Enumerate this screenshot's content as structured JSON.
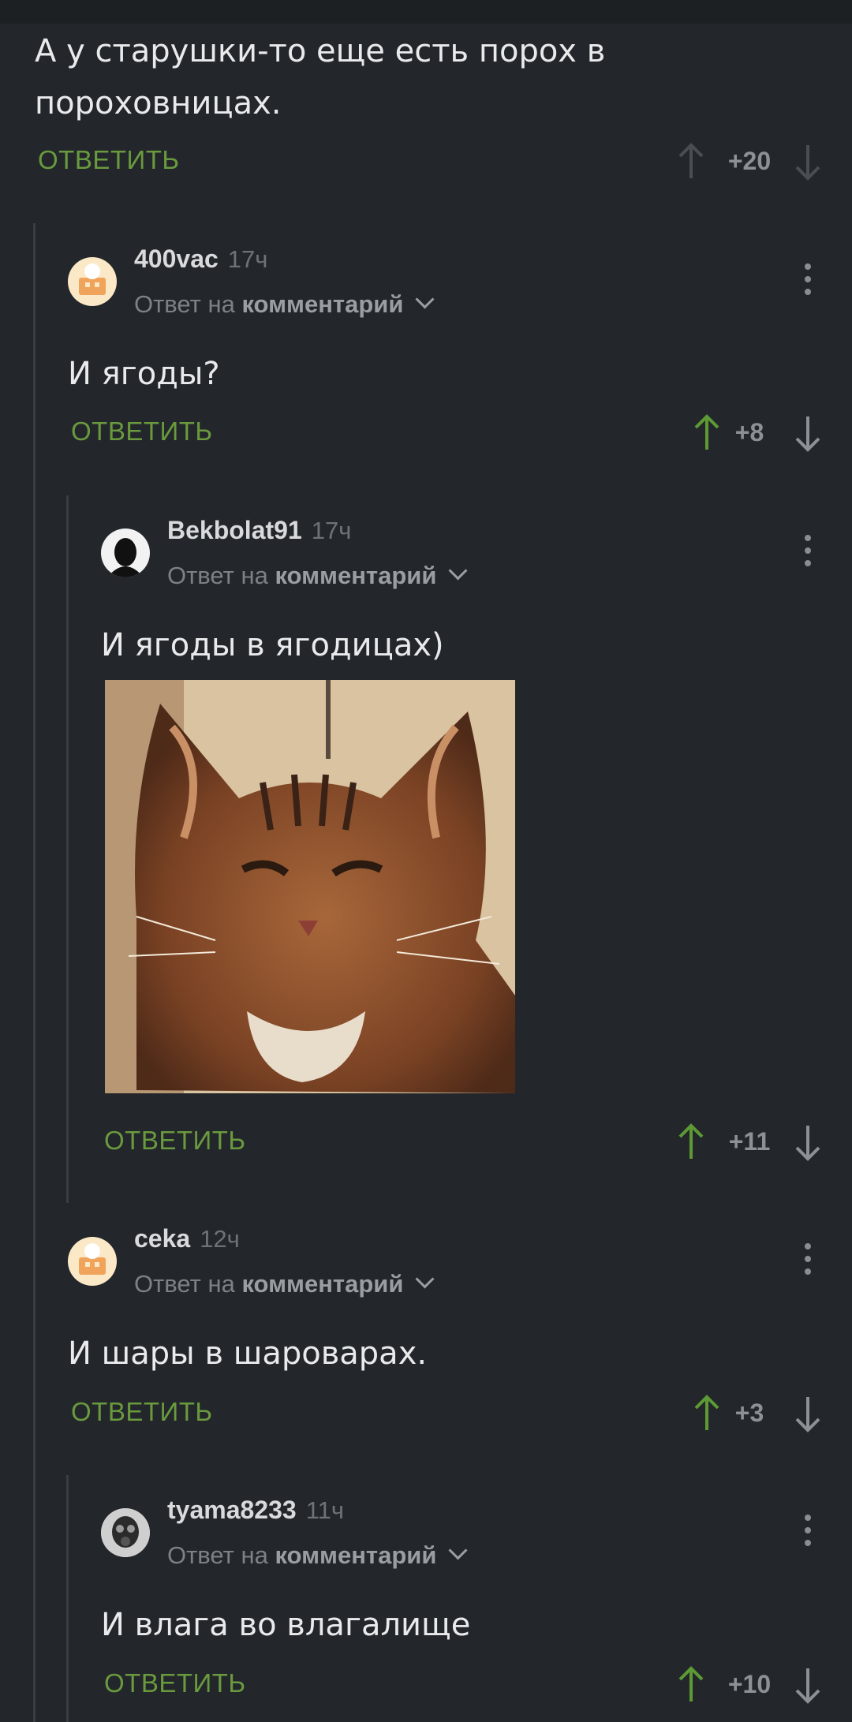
{
  "comments": [
    {
      "text": "А у старушки-то еще есть порох в пороховницах.",
      "reply": "ОТВЕТИТЬ",
      "rating": "+20"
    },
    {
      "user": "400vac",
      "time": "17ч",
      "reply_to_prefix": "Ответ на",
      "reply_to_link": "комментарий",
      "text": "И ягоды?",
      "reply": "ОТВЕТИТЬ",
      "rating": "+8"
    },
    {
      "user": "Bekbolat91",
      "time": "17ч",
      "reply_to_prefix": "Ответ на",
      "reply_to_link": "комментарий",
      "text": "И ягоды в ягодицах)",
      "reply": "ОТВЕТИТЬ",
      "rating": "+11",
      "image": "cat-photo"
    },
    {
      "user": "ceka",
      "time": "12ч",
      "reply_to_prefix": "Ответ на",
      "reply_to_link": "комментарий",
      "text": "И шары в шароварах.",
      "reply": "ОТВЕТИТЬ",
      "rating": "+3"
    },
    {
      "user": "tyama8233",
      "time": "11ч",
      "reply_to_prefix": "Ответ на",
      "reply_to_link": "комментарий",
      "text": "И влага во влагалище",
      "reply": "ОТВЕТИТЬ",
      "rating": "+10"
    }
  ],
  "colors": {
    "background": "#23272b",
    "reply_green": "#6a9a3e",
    "upvote_active": "#5d9a35",
    "muted": "#8d9196"
  }
}
